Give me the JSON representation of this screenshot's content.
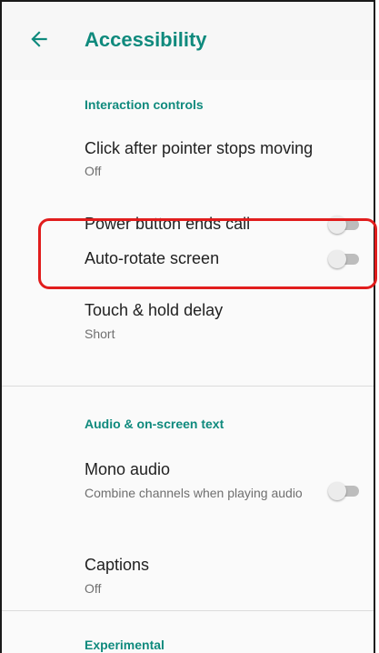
{
  "appbar": {
    "back_icon": "arrow-back-icon",
    "title": "Accessibility"
  },
  "sections": {
    "interaction": {
      "header": "Interaction controls",
      "click_after_pointer": {
        "title": "Click after pointer stops moving",
        "summary": "Off"
      },
      "power_button": {
        "title": "Power button ends call",
        "toggle": "off"
      },
      "auto_rotate": {
        "title": "Auto-rotate screen",
        "toggle": "off",
        "highlighted": true
      },
      "touch_hold": {
        "title": "Touch & hold delay",
        "summary": "Short"
      }
    },
    "audio": {
      "header": "Audio & on-screen text",
      "mono_audio": {
        "title": "Mono audio",
        "summary": "Combine channels when playing audio",
        "toggle": "off"
      },
      "captions": {
        "title": "Captions",
        "summary": "Off"
      }
    },
    "experimental": {
      "header": "Experimental"
    }
  },
  "colors": {
    "accent": "#0f8a7d",
    "highlight": "#e11d1d",
    "toggle_track_off": "#bdbdbd",
    "toggle_thumb_off": "#ececec"
  }
}
